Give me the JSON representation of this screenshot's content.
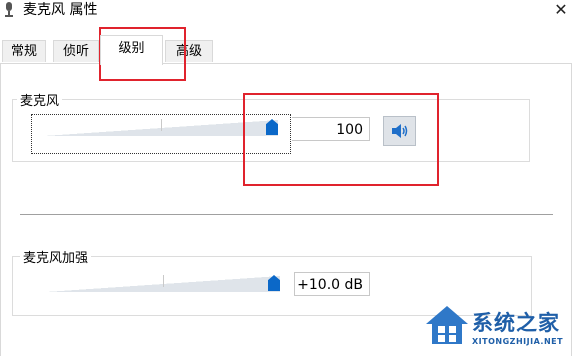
{
  "window": {
    "title": "麦克风 属性",
    "close_glyph": "✕",
    "microphone_icon": "microphone-icon"
  },
  "tabs": [
    {
      "label": "常规",
      "active": false
    },
    {
      "label": "侦听",
      "active": false
    },
    {
      "label": "级别",
      "active": true
    },
    {
      "label": "高级",
      "active": false
    }
  ],
  "levels": {
    "microphone": {
      "label": "麦克风",
      "value_text": "100",
      "level_fraction": 1.0,
      "mute_icon": "speaker-icon"
    },
    "boost": {
      "label": "麦克风加强",
      "value_text": "+10.0 dB",
      "level_fraction": 1.0
    }
  },
  "colors": {
    "thumb": "#0b68c8",
    "annotation": "#e0232d"
  },
  "watermark": {
    "text": "系统之家",
    "subtext": "XITONGZHIJIA.NET",
    "icon": "house-logo-icon"
  }
}
